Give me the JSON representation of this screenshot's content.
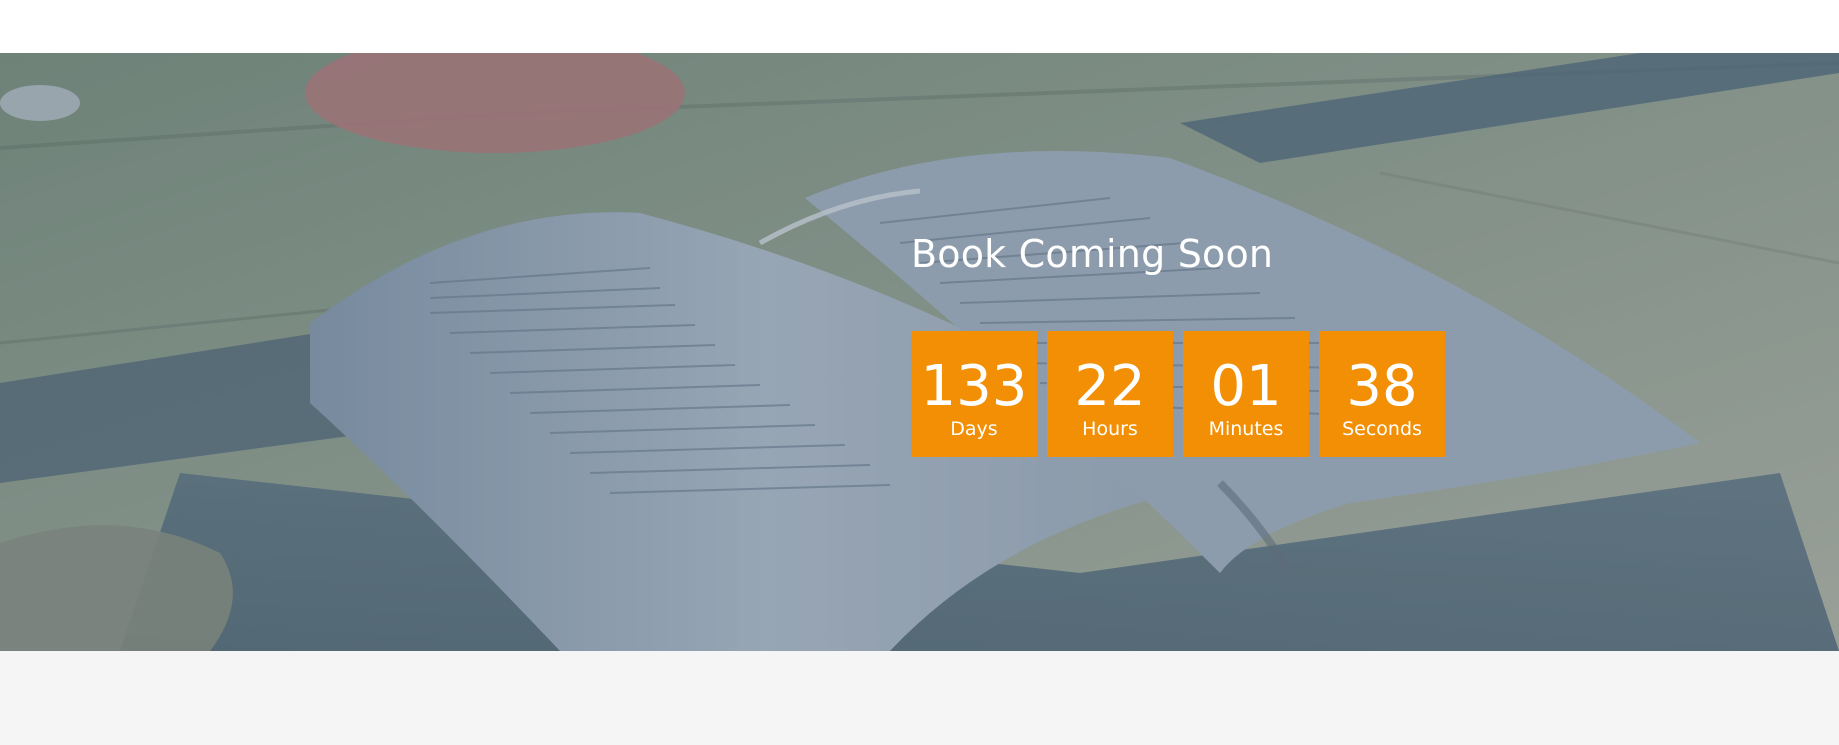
{
  "hero": {
    "title": "Book Coming Soon",
    "countdown": [
      {
        "value": "133",
        "label": "Days"
      },
      {
        "value": "22",
        "label": "Hours"
      },
      {
        "value": "01",
        "label": "Minutes"
      },
      {
        "value": "38",
        "label": "Seconds"
      }
    ]
  },
  "colors": {
    "accent": "#f28f05",
    "footer_bg": "#f5f5f5"
  }
}
